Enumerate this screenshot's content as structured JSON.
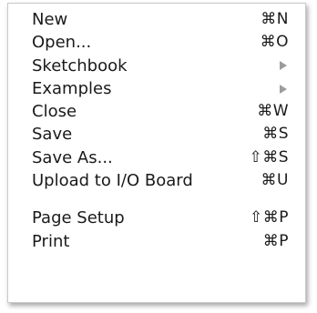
{
  "menu": {
    "items": [
      {
        "label": "New",
        "shortcut": "⌘N"
      },
      {
        "label": "Open...",
        "shortcut": "⌘O"
      },
      {
        "label": "Sketchbook",
        "submenu_icon": "submenu-arrow-icon"
      },
      {
        "label": "Examples",
        "submenu_icon": "submenu-arrow-icon"
      },
      {
        "label": "Close",
        "shortcut": "⌘W"
      },
      {
        "label": "Save",
        "shortcut": "⌘S"
      },
      {
        "label": "Save As...",
        "shortcut": "⇧⌘S"
      },
      {
        "label": "Upload to I/O Board",
        "shortcut": "⌘U"
      },
      {
        "label": "Page Setup",
        "shortcut": "⇧⌘P"
      },
      {
        "label": "Print",
        "shortcut": "⌘P"
      }
    ]
  }
}
